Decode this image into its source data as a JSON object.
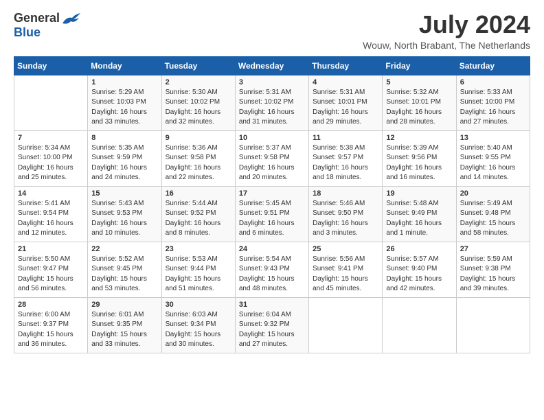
{
  "header": {
    "logo_general": "General",
    "logo_blue": "Blue",
    "month_title": "July 2024",
    "location": "Wouw, North Brabant, The Netherlands"
  },
  "weekdays": [
    "Sunday",
    "Monday",
    "Tuesday",
    "Wednesday",
    "Thursday",
    "Friday",
    "Saturday"
  ],
  "weeks": [
    [
      {
        "day": "",
        "sunrise": "",
        "sunset": "",
        "daylight": ""
      },
      {
        "day": "1",
        "sunrise": "Sunrise: 5:29 AM",
        "sunset": "Sunset: 10:03 PM",
        "daylight": "Daylight: 16 hours and 33 minutes."
      },
      {
        "day": "2",
        "sunrise": "Sunrise: 5:30 AM",
        "sunset": "Sunset: 10:02 PM",
        "daylight": "Daylight: 16 hours and 32 minutes."
      },
      {
        "day": "3",
        "sunrise": "Sunrise: 5:31 AM",
        "sunset": "Sunset: 10:02 PM",
        "daylight": "Daylight: 16 hours and 31 minutes."
      },
      {
        "day": "4",
        "sunrise": "Sunrise: 5:31 AM",
        "sunset": "Sunset: 10:01 PM",
        "daylight": "Daylight: 16 hours and 29 minutes."
      },
      {
        "day": "5",
        "sunrise": "Sunrise: 5:32 AM",
        "sunset": "Sunset: 10:01 PM",
        "daylight": "Daylight: 16 hours and 28 minutes."
      },
      {
        "day": "6",
        "sunrise": "Sunrise: 5:33 AM",
        "sunset": "Sunset: 10:00 PM",
        "daylight": "Daylight: 16 hours and 27 minutes."
      }
    ],
    [
      {
        "day": "7",
        "sunrise": "Sunrise: 5:34 AM",
        "sunset": "Sunset: 10:00 PM",
        "daylight": "Daylight: 16 hours and 25 minutes."
      },
      {
        "day": "8",
        "sunrise": "Sunrise: 5:35 AM",
        "sunset": "Sunset: 9:59 PM",
        "daylight": "Daylight: 16 hours and 24 minutes."
      },
      {
        "day": "9",
        "sunrise": "Sunrise: 5:36 AM",
        "sunset": "Sunset: 9:58 PM",
        "daylight": "Daylight: 16 hours and 22 minutes."
      },
      {
        "day": "10",
        "sunrise": "Sunrise: 5:37 AM",
        "sunset": "Sunset: 9:58 PM",
        "daylight": "Daylight: 16 hours and 20 minutes."
      },
      {
        "day": "11",
        "sunrise": "Sunrise: 5:38 AM",
        "sunset": "Sunset: 9:57 PM",
        "daylight": "Daylight: 16 hours and 18 minutes."
      },
      {
        "day": "12",
        "sunrise": "Sunrise: 5:39 AM",
        "sunset": "Sunset: 9:56 PM",
        "daylight": "Daylight: 16 hours and 16 minutes."
      },
      {
        "day": "13",
        "sunrise": "Sunrise: 5:40 AM",
        "sunset": "Sunset: 9:55 PM",
        "daylight": "Daylight: 16 hours and 14 minutes."
      }
    ],
    [
      {
        "day": "14",
        "sunrise": "Sunrise: 5:41 AM",
        "sunset": "Sunset: 9:54 PM",
        "daylight": "Daylight: 16 hours and 12 minutes."
      },
      {
        "day": "15",
        "sunrise": "Sunrise: 5:43 AM",
        "sunset": "Sunset: 9:53 PM",
        "daylight": "Daylight: 16 hours and 10 minutes."
      },
      {
        "day": "16",
        "sunrise": "Sunrise: 5:44 AM",
        "sunset": "Sunset: 9:52 PM",
        "daylight": "Daylight: 16 hours and 8 minutes."
      },
      {
        "day": "17",
        "sunrise": "Sunrise: 5:45 AM",
        "sunset": "Sunset: 9:51 PM",
        "daylight": "Daylight: 16 hours and 6 minutes."
      },
      {
        "day": "18",
        "sunrise": "Sunrise: 5:46 AM",
        "sunset": "Sunset: 9:50 PM",
        "daylight": "Daylight: 16 hours and 3 minutes."
      },
      {
        "day": "19",
        "sunrise": "Sunrise: 5:48 AM",
        "sunset": "Sunset: 9:49 PM",
        "daylight": "Daylight: 16 hours and 1 minute."
      },
      {
        "day": "20",
        "sunrise": "Sunrise: 5:49 AM",
        "sunset": "Sunset: 9:48 PM",
        "daylight": "Daylight: 15 hours and 58 minutes."
      }
    ],
    [
      {
        "day": "21",
        "sunrise": "Sunrise: 5:50 AM",
        "sunset": "Sunset: 9:47 PM",
        "daylight": "Daylight: 15 hours and 56 minutes."
      },
      {
        "day": "22",
        "sunrise": "Sunrise: 5:52 AM",
        "sunset": "Sunset: 9:45 PM",
        "daylight": "Daylight: 15 hours and 53 minutes."
      },
      {
        "day": "23",
        "sunrise": "Sunrise: 5:53 AM",
        "sunset": "Sunset: 9:44 PM",
        "daylight": "Daylight: 15 hours and 51 minutes."
      },
      {
        "day": "24",
        "sunrise": "Sunrise: 5:54 AM",
        "sunset": "Sunset: 9:43 PM",
        "daylight": "Daylight: 15 hours and 48 minutes."
      },
      {
        "day": "25",
        "sunrise": "Sunrise: 5:56 AM",
        "sunset": "Sunset: 9:41 PM",
        "daylight": "Daylight: 15 hours and 45 minutes."
      },
      {
        "day": "26",
        "sunrise": "Sunrise: 5:57 AM",
        "sunset": "Sunset: 9:40 PM",
        "daylight": "Daylight: 15 hours and 42 minutes."
      },
      {
        "day": "27",
        "sunrise": "Sunrise: 5:59 AM",
        "sunset": "Sunset: 9:38 PM",
        "daylight": "Daylight: 15 hours and 39 minutes."
      }
    ],
    [
      {
        "day": "28",
        "sunrise": "Sunrise: 6:00 AM",
        "sunset": "Sunset: 9:37 PM",
        "daylight": "Daylight: 15 hours and 36 minutes."
      },
      {
        "day": "29",
        "sunrise": "Sunrise: 6:01 AM",
        "sunset": "Sunset: 9:35 PM",
        "daylight": "Daylight: 15 hours and 33 minutes."
      },
      {
        "day": "30",
        "sunrise": "Sunrise: 6:03 AM",
        "sunset": "Sunset: 9:34 PM",
        "daylight": "Daylight: 15 hours and 30 minutes."
      },
      {
        "day": "31",
        "sunrise": "Sunrise: 6:04 AM",
        "sunset": "Sunset: 9:32 PM",
        "daylight": "Daylight: 15 hours and 27 minutes."
      },
      {
        "day": "",
        "sunrise": "",
        "sunset": "",
        "daylight": ""
      },
      {
        "day": "",
        "sunrise": "",
        "sunset": "",
        "daylight": ""
      },
      {
        "day": "",
        "sunrise": "",
        "sunset": "",
        "daylight": ""
      }
    ]
  ]
}
